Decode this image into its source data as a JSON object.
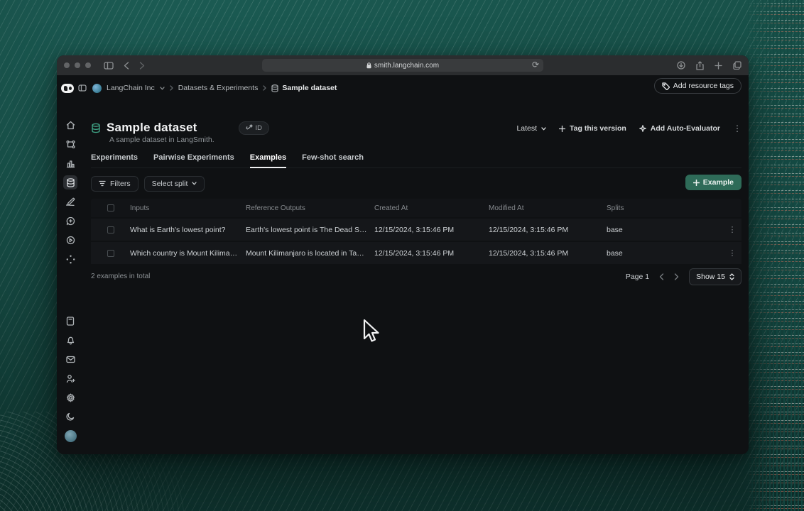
{
  "browser": {
    "url": "smith.langchain.com"
  },
  "breadcrumb": {
    "org": "LangChain Inc",
    "section": "Datasets & Experiments",
    "current": "Sample dataset"
  },
  "header": {
    "add_resource_tags": "Add resource tags"
  },
  "dataset": {
    "title": "Sample dataset",
    "subtitle": "A sample dataset in LangSmith.",
    "id_badge": "ID"
  },
  "version_actions": {
    "latest": "Latest",
    "tag_version": "Tag this version",
    "auto_evaluator": "Add Auto-Evaluator"
  },
  "tabs": [
    {
      "label": "Experiments"
    },
    {
      "label": "Pairwise Experiments"
    },
    {
      "label": "Examples"
    },
    {
      "label": "Few-shot search"
    }
  ],
  "toolbar": {
    "filters": "Filters",
    "select_split": "Select split",
    "add_example": "Example"
  },
  "table": {
    "columns": [
      "Inputs",
      "Reference Outputs",
      "Created At",
      "Modified At",
      "Splits"
    ],
    "rows": [
      {
        "inputs": "What is Earth's lowest point?",
        "reference_outputs": "Earth's lowest point is The Dead Sea.",
        "created_at": "12/15/2024, 3:15:46 PM",
        "modified_at": "12/15/2024, 3:15:46 PM",
        "splits": "base"
      },
      {
        "inputs": "Which country is Mount Kilimanjaro...",
        "reference_outputs": "Mount Kilimanjaro is located in Tanzania.",
        "created_at": "12/15/2024, 3:15:46 PM",
        "modified_at": "12/15/2024, 3:15:46 PM",
        "splits": "base"
      }
    ]
  },
  "pagination": {
    "total": "2 examples in total",
    "page": "Page 1",
    "page_size": "Show 15"
  },
  "icons": {
    "kebab": "⋮",
    "plus": "+",
    "reload": "⟳"
  },
  "colors": {
    "accent_green": "#2e6b58",
    "background_teal": "#175048",
    "dataset_icon_green": "#3fa284",
    "app_background": "#0f1113",
    "chrome_bar": "#2b2d2f"
  }
}
